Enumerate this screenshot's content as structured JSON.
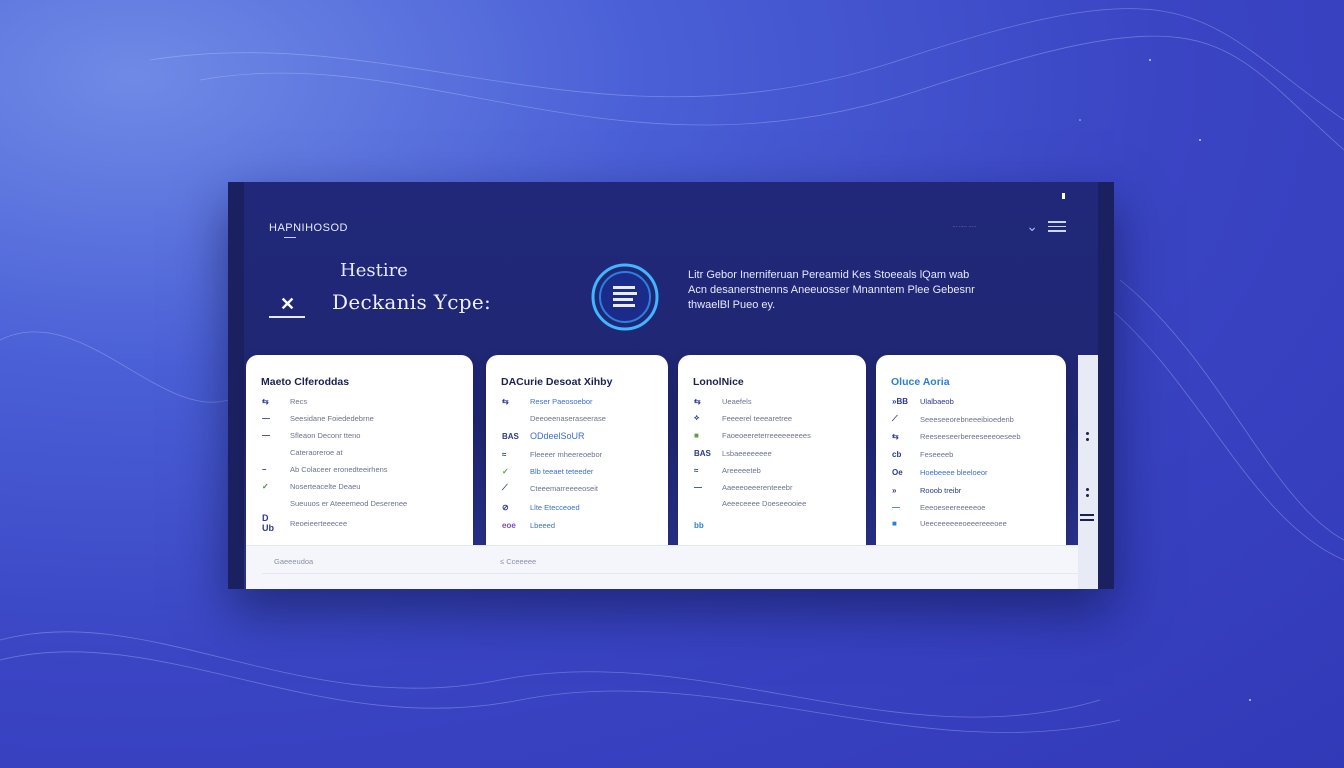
{
  "header": {
    "brand": "HAPNIHOSOD",
    "top_right_text": "··· ····· ·····",
    "hero_title_1": "Hestire",
    "hero_title_2": "Deckanis Ycpe:",
    "hero_desc": "Litr Gebor Inerniferuan Pereamid Kes Stoeeals lQam wab Acn desanerstnenns Aneeuosser Mnanntem Plee Gebesnr thwaelBl Pueo ey."
  },
  "cards": [
    {
      "title": "Maeto Clferoddas",
      "rows": [
        {
          "icon": "⇆",
          "label": "Recs"
        },
        {
          "icon": "—",
          "label": "Seesidane Foiededebrne"
        },
        {
          "icon": "—",
          "label": "Sfleaon Deconr tteno"
        },
        {
          "icon": "",
          "label": "Cateraoreroe at"
        },
        {
          "icon": "–",
          "label": "Ab Colaceer eronedteeirhens"
        },
        {
          "icon": "✓",
          "label": "Noserteacelte Deaeu"
        },
        {
          "icon": "",
          "label": "Sueuuos er Ateeemeod Deserenee"
        },
        {
          "icon": "D Ub",
          "label": "Reoeieerteeecee"
        }
      ]
    },
    {
      "title": "DACurie Desoat Xihby",
      "rows": [
        {
          "icon": "⇆",
          "label": "Reser Paeosoebor"
        },
        {
          "icon": "",
          "label": "Deeoeenaseraseerase"
        },
        {
          "icon": "BAS",
          "label": "ODdeelSoUR"
        },
        {
          "icon": "≈",
          "label": "Fleeeer mheereoebor"
        },
        {
          "icon": "✓",
          "label": "Blb teeaet teteeder"
        },
        {
          "icon": "⟋",
          "label": "Cteeemarreeeeoseit"
        },
        {
          "icon": "⊘",
          "label": "Llte Etecceoed"
        },
        {
          "icon": "eoe",
          "label": "Lbeeed"
        }
      ]
    },
    {
      "title": "LonolNice",
      "rows": [
        {
          "icon": "⇆",
          "label": "Ueaefels"
        },
        {
          "icon": "⟡",
          "label": "Feeeerel teeearetree"
        },
        {
          "icon": "■",
          "label": "Faoeoeereterreeeeeeeees"
        },
        {
          "icon": "BAS",
          "label": "Lsbaeeeeeeee"
        },
        {
          "icon": "≈",
          "label": "Areeeeeteb"
        },
        {
          "icon": "—",
          "label": "Aaeeeoeeerenteeebr"
        },
        {
          "icon": "",
          "label": "Aeeeceeee Doeseeooiee"
        },
        {
          "icon": "bb",
          "label": ""
        }
      ]
    },
    {
      "title": "Oluce Aoria",
      "rows": [
        {
          "icon": "»BB",
          "label": "Ulalbaeob"
        },
        {
          "icon": "⟋",
          "label": "Seeeseeorebneeeibioedenb"
        },
        {
          "icon": "⇆",
          "label": "Reeseeseerbereeseeeoeseeb"
        },
        {
          "icon": "cb",
          "label": "Feseeeeb"
        },
        {
          "icon": "Oe",
          "label": "Hoebeeee bleeloeor"
        },
        {
          "icon": "»",
          "label": "Rooob treibr"
        },
        {
          "icon": "—",
          "label": "Eeeoeseereeeeeoe"
        },
        {
          "icon": "■",
          "label": "Ueeceeeeeeoeeereeeoee"
        }
      ]
    }
  ],
  "footer": {
    "left_label": "Gaeeeudoa",
    "right_label": "≤ Cceeeee"
  },
  "colors": {
    "background": "#3a45c4",
    "window": "#21287a",
    "accent": "#2a7fd6",
    "card_bg": "#ffffff"
  }
}
